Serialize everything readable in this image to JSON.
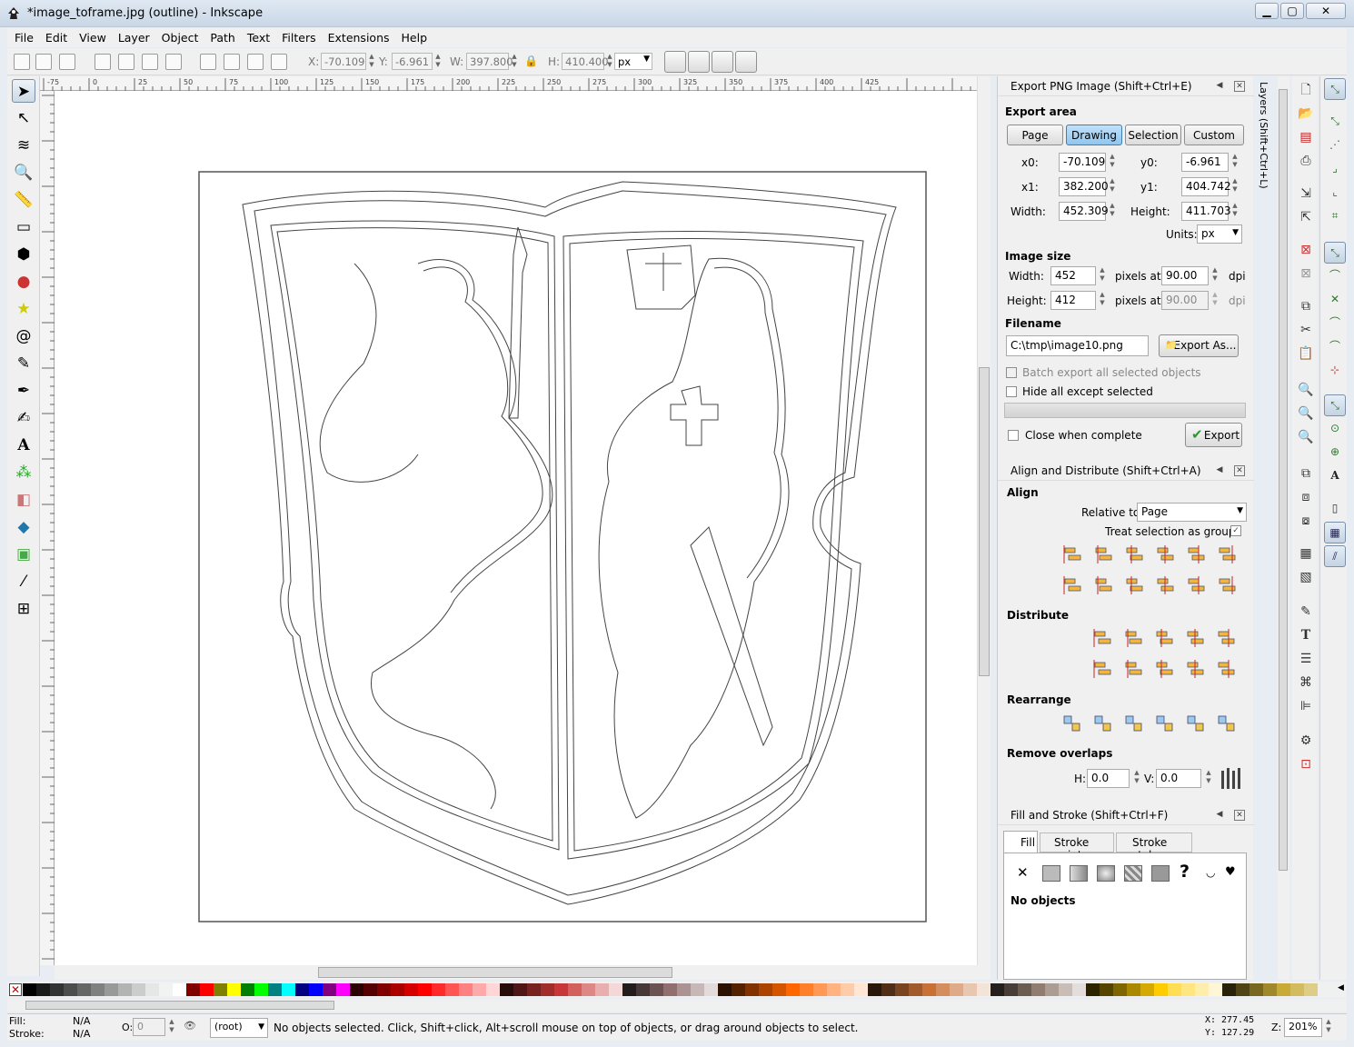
{
  "window": {
    "title": "*image_toframe.jpg (outline) - Inkscape"
  },
  "menu": [
    "File",
    "Edit",
    "View",
    "Layer",
    "Object",
    "Path",
    "Text",
    "Filters",
    "Extensions",
    "Help"
  ],
  "toolbar": {
    "x_label": "X:",
    "x": "-70.109",
    "y_label": "Y:",
    "y": "-6.961",
    "w_label": "W:",
    "w": "397.800",
    "h_label": "H:",
    "h": "410.400",
    "unit": "px"
  },
  "rulers": {
    "h_ticks": [
      "-75",
      "0",
      "25",
      "50",
      "75",
      "100",
      "125",
      "150",
      "175",
      "200",
      "225",
      "250",
      "275",
      "300",
      "325",
      "350",
      "375",
      "400",
      "425"
    ],
    "v_ticks": [
      "2",
      "2",
      "3",
      "3",
      "5",
      "4",
      "5",
      "0",
      "0",
      "1",
      "1",
      "0"
    ]
  },
  "export_png": {
    "title": "Export PNG Image (Shift+Ctrl+E)",
    "export_area": "Export area",
    "area_buttons": [
      "Page",
      "Drawing",
      "Selection",
      "Custom"
    ],
    "selected_area": "Drawing",
    "x0_label": "x0:",
    "x0": "-70.109",
    "y0_label": "y0:",
    "y0": "-6.961",
    "x1_label": "x1:",
    "x1": "382.200",
    "y1_label": "y1:",
    "y1": "404.742",
    "width_label": "Width:",
    "width": "452.309",
    "height_label": "Height:",
    "height": "411.703",
    "units_label": "Units:",
    "units": "px",
    "image_size": "Image size",
    "img_width_label": "Width:",
    "img_width": "452",
    "img_height_label": "Height:",
    "img_height": "412",
    "pixels_at": "pixels at",
    "dpi1": "90.00",
    "dpi2": "90.00",
    "dpi": "dpi",
    "filename_label": "Filename",
    "filename": "C:\\tmp\\image10.png",
    "export_as": "Export As...",
    "batch": "Batch export all selected objects",
    "hide": "Hide all except selected",
    "close": "Close when complete",
    "export": "Export"
  },
  "align": {
    "title": "Align and Distribute (Shift+Ctrl+A)",
    "align": "Align",
    "relative_to_label": "Relative to:",
    "relative_to": "Page",
    "treat_group": "Treat selection as group:",
    "distribute": "Distribute",
    "rearrange": "Rearrange",
    "remove_overlaps": "Remove overlaps",
    "h_label": "H:",
    "h": "0.0",
    "v_label": "V:",
    "v": "0.0"
  },
  "fill_stroke": {
    "title": "Fill and Stroke (Shift+Ctrl+F)",
    "tabs": [
      "Fill",
      "Stroke paint",
      "Stroke style"
    ],
    "no_objects": "No objects"
  },
  "side_tab": "Layers (Shift+Ctrl+L)",
  "status": {
    "fill_label": "Fill:",
    "fill": "N/A",
    "stroke_label": "Stroke:",
    "stroke": "N/A",
    "opacity_label": "O:",
    "opacity": "0",
    "layer": "(root)",
    "message": "No objects selected. Click, Shift+click, Alt+scroll mouse on top of objects, or drag around objects to select.",
    "x_label": "X:",
    "x": "277.45",
    "y_label": "Y:",
    "y": "127.29",
    "zoom_label": "Z:",
    "zoom": "201%"
  },
  "palette": [
    "#000000",
    "#1a1a1a",
    "#333333",
    "#4d4d4d",
    "#666666",
    "#808080",
    "#999999",
    "#b3b3b3",
    "#cccccc",
    "#e6e6e6",
    "#f2f2f2",
    "#ffffff",
    "#800000",
    "#ff0000",
    "#808000",
    "#ffff00",
    "#008000",
    "#00ff00",
    "#008080",
    "#00ffff",
    "#000080",
    "#0000ff",
    "#800080",
    "#ff00ff",
    "#2b0000",
    "#550000",
    "#800000",
    "#aa0000",
    "#d40000",
    "#ff0000",
    "#ff2a2a",
    "#ff5555",
    "#ff8080",
    "#ffaaaa",
    "#ffd5d5",
    "#280b0b",
    "#501616",
    "#782121",
    "#a02c2c",
    "#c83737",
    "#d35f5f",
    "#de8787",
    "#e9afaf",
    "#f4d7d7",
    "#241c1c",
    "#483737",
    "#6c5353",
    "#916f6f",
    "#ac9393",
    "#c8b7b7",
    "#e3dbdb",
    "#2b1100",
    "#552200",
    "#803300",
    "#aa4400",
    "#d45500",
    "#ff6600",
    "#ff7f2a",
    "#ff9955",
    "#ffb380",
    "#ffccaa",
    "#ffe6d5",
    "#28170b",
    "#502d16",
    "#784421",
    "#a05a2c",
    "#c87137",
    "#d38d5f",
    "#deaa87",
    "#e9c6af",
    "#f4e3d7",
    "#241f1c",
    "#483e37",
    "#6c5d53",
    "#917c6f",
    "#ac9d93",
    "#c8beb7",
    "#e3dedb",
    "#2b2200",
    "#554400",
    "#806600",
    "#aa8800",
    "#d4aa00",
    "#ffcc00",
    "#ffdd55",
    "#ffe680",
    "#ffeeaa",
    "#fff6d5",
    "#28220b",
    "#504416",
    "#786721",
    "#a0892c",
    "#c8ab37",
    "#d3bc5f",
    "#decd87"
  ]
}
